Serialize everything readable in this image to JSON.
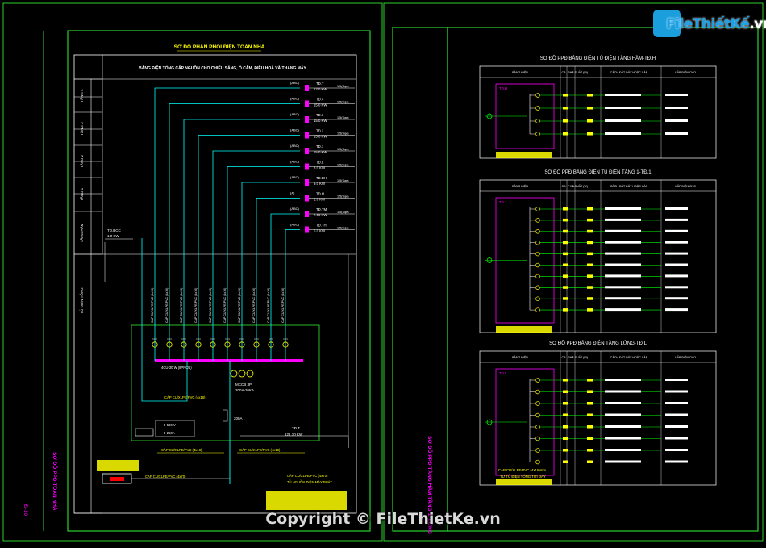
{
  "brand": {
    "logo_text": "FileThiếtKế",
    "logo_suffix": ".vn",
    "watermark": "Copyright © FileThietKe.vn"
  },
  "colors": {
    "background": "#000000",
    "frame": "#2bd12b",
    "title": "#ffff00",
    "magenta": "#ff00ff",
    "cyan": "#00ffff",
    "white": "#ffffff",
    "red": "#ff0000",
    "green": "#00ff00"
  },
  "left_sheet": {
    "title": "SƠ ĐỒ PHÂN PHỐI ĐIỆN TOÀN NHÀ",
    "header": "BẢNG ĐIỆN TỔNG CẤP NGUỒN CHO CHIẾU SÁNG, Ổ CẮM, ĐIỀU HOÀ VÀ THANG MÁY",
    "floor_labels": [
      "TẦNG 4",
      "TẦNG 3",
      "TẦNG 2",
      "TẦNG 1",
      "TẦNG HẦM",
      "TỦ ĐIỆN TỔNG"
    ],
    "boards": [
      {
        "id": "TĐ.T",
        "kw": "12.0 KW",
        "breaker": "(ABC)",
        "cable": "1.5(Sqe)"
      },
      {
        "id": "TĐ.4",
        "kw": "15.0 KW",
        "breaker": "(ABC)",
        "cable": "1.5(Sqe)"
      },
      {
        "id": "TĐ.3",
        "kw": "15.0 KW",
        "breaker": "(ABC)",
        "cable": "1.5(Sqe)"
      },
      {
        "id": "TĐ.2",
        "kw": "15.0 KW",
        "breaker": "(ABC)",
        "cable": "1.5(Sqe)"
      },
      {
        "id": "TĐ.1",
        "kw": "15.0 KW",
        "breaker": "(ABC)",
        "cable": "1.5(Sqe)"
      },
      {
        "id": "TĐ.L",
        "kw": "8.0 KW",
        "breaker": "(ABC)",
        "cable": "1.5(Sqe)"
      },
      {
        "id": "TĐ.DH",
        "kw": "9.0 KW",
        "breaker": "(ABC)",
        "cable": "1.5(Sqe)"
      },
      {
        "id": "TĐ.H",
        "kw": "2.6 KW",
        "breaker": "(A)",
        "cable": "1.5(Sqe)"
      },
      {
        "id": "TĐ.TM",
        "kw": "7.50 KW",
        "breaker": "(ABC)",
        "cable": "1.5(Sqe)"
      },
      {
        "id": "TĐ.TH",
        "kw": "5.0 KW",
        "breaker": "(ABC)",
        "cable": "1.5(Sqe)"
      }
    ],
    "left_board": {
      "id": "TĐ.BCC",
      "kw": "1.0 KW"
    },
    "feeder_label": "CÁP CU/XLPE/PVC (4x16)",
    "busbar_label": "4CU-30 W (8PNCU)",
    "main_breaker": {
      "name": "MCCB 3P",
      "rating": "200A-36KA"
    },
    "ats_rating": "200A",
    "meter": {
      "voltage": "0-500 V",
      "current": "0-250A"
    },
    "generator_label": "CÁP CU/XLPE/PVC (4x70)",
    "main_cable": "CÁP CU/XLPE/PVC (4x70)",
    "legend_title": "TỦ NGUỒN ĐIỆN MÁY PHÁT",
    "riser_label": "TĐ.T",
    "riser_value": "121.30 KW",
    "sheet_label": "SƠ ĐỒ PPĐ TOÀN NHÀ",
    "sheet_number": "Đ-10"
  },
  "right_sheet": {
    "sheet_label": "SƠ ĐỒ PPĐ TẦNG HẦM TẦNG 1, LỬNG",
    "column_headers": [
      "BẢNG ĐIỆN",
      "CB",
      "PHA",
      "C.SUẤT (W)",
      "CÁCH ĐẶT DÂY HOẶC CÁP",
      "CẤP ĐIỆN CHO"
    ],
    "tables": [
      {
        "title": "SƠ ĐỒ PPĐ BẢNG ĐIỆN TỦ ĐIỆN TẦNG HẦM-TĐ.H",
        "board": "TĐ.H",
        "rows": 4
      },
      {
        "title": "SƠ ĐỒ PPĐ BẢNG ĐIỆN TỦ ĐIỆN TẦNG 1-TĐ.1",
        "board": "TĐ.1",
        "rows": 10
      },
      {
        "title": "SƠ ĐỒ PPĐ BẢNG ĐIỆN TẦNG LỬNG-TĐ.L",
        "board": "TĐ.L",
        "rows": 8
      }
    ],
    "footer_cable": "CÁP CU/XLPE/PVC (4x16)mm",
    "footer_note": "TỪ TỦ ĐIỆN TỔNG TỚI ĐÂY"
  }
}
